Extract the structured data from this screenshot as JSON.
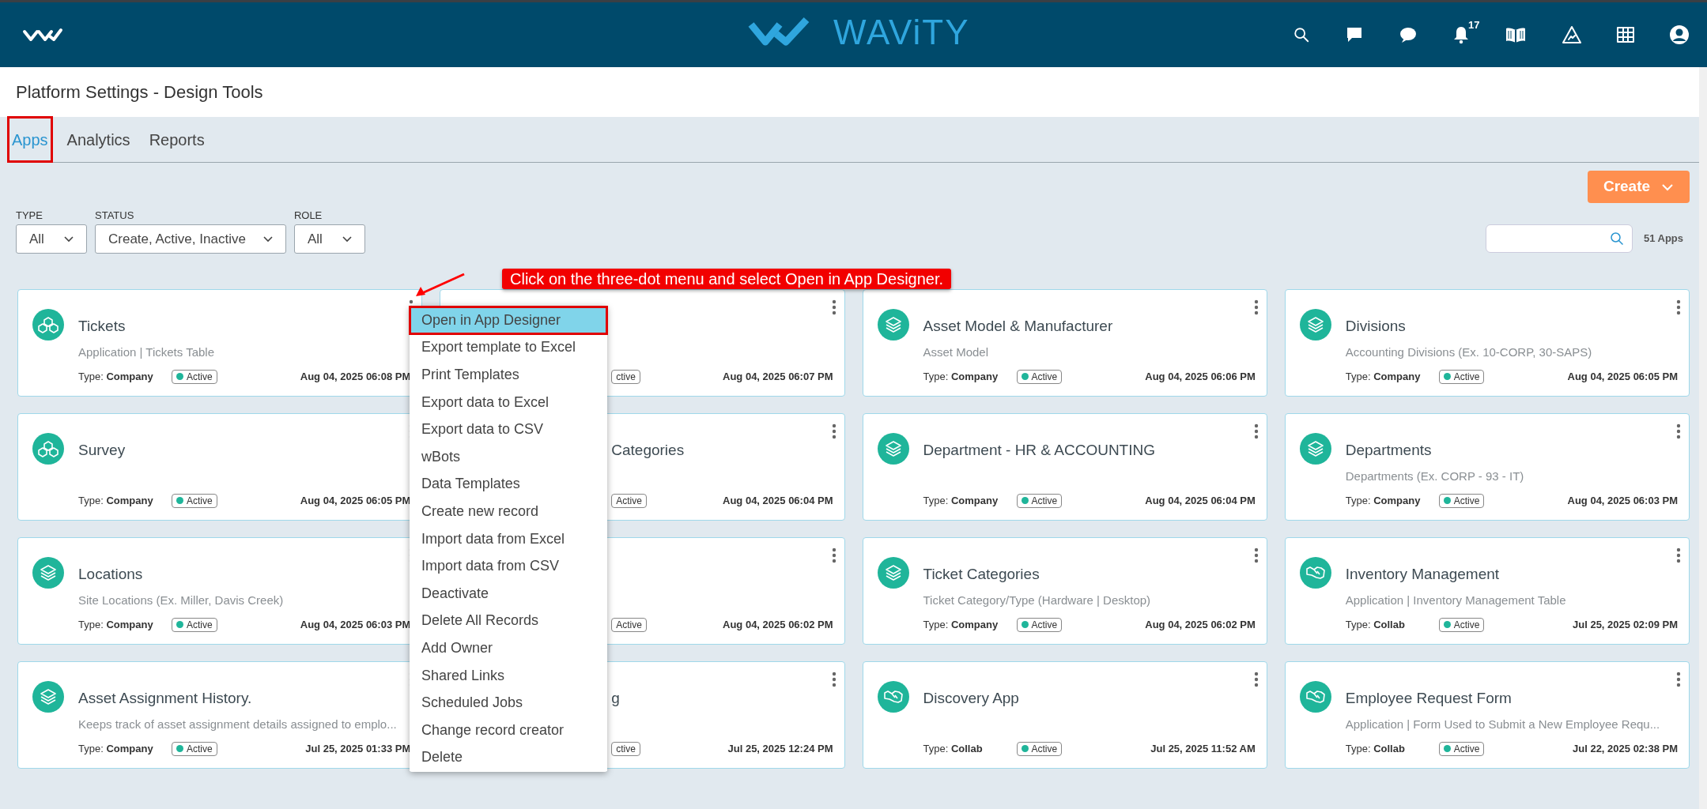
{
  "header": {
    "logo_text": "WAViTY",
    "notification_count": "17"
  },
  "page_title": "Platform Settings - Design Tools",
  "tabs": [
    {
      "label": "Apps",
      "selected": true,
      "highlighted": true
    },
    {
      "label": "Analytics",
      "selected": false,
      "highlighted": false
    },
    {
      "label": "Reports",
      "selected": false,
      "highlighted": false
    }
  ],
  "create_button": "Create",
  "filters": [
    {
      "label": "TYPE",
      "value": "All"
    },
    {
      "label": "STATUS",
      "value": "Create, Active, Inactive"
    },
    {
      "label": "ROLE",
      "value": "All"
    }
  ],
  "app_count": "51 Apps",
  "annotation": {
    "text": "Click on the three-dot menu and select Open in App Designer."
  },
  "cards": [
    {
      "kind": "cubes",
      "covered": false,
      "title": "Tickets",
      "subtitle": "Application | Tickets Table",
      "type_label": "Type:",
      "type": "Company",
      "status": "Active",
      "date": "Aug 04, 2025 06:08 PM"
    },
    {
      "covered": true,
      "status": "ctive",
      "date": "Aug 04, 2025 06:07 PM"
    },
    {
      "kind": "layers",
      "covered": false,
      "title": "Asset Model & Manufacturer",
      "subtitle": "Asset Model",
      "type_label": "Type:",
      "type": "Company",
      "status": "Active",
      "date": "Aug 04, 2025 06:06 PM"
    },
    {
      "kind": "layers",
      "covered": false,
      "title": "Divisions",
      "subtitle": "Accounting Divisions (Ex. 10-CORP, 30-SAPS)",
      "type_label": "Type:",
      "type": "Company",
      "status": "Active",
      "date": "Aug 04, 2025 06:05 PM"
    },
    {
      "kind": "cubes",
      "covered": false,
      "title": "Survey",
      "type_label": "Type:",
      "type": "Company",
      "status": "Active",
      "date": "Aug 04, 2025 06:05 PM"
    },
    {
      "covered": true,
      "title": "Categories",
      "status": "Active",
      "date": "Aug 04, 2025 06:04 PM"
    },
    {
      "kind": "layers",
      "covered": false,
      "title": "Department - HR & ACCOUNTING",
      "type_label": "Type:",
      "type": "Company",
      "status": "Active",
      "date": "Aug 04, 2025 06:04 PM"
    },
    {
      "kind": "layers",
      "covered": false,
      "title": "Departments",
      "subtitle": "Departments (Ex. CORP - 93 - IT)",
      "type_label": "Type:",
      "type": "Company",
      "status": "Active",
      "date": "Aug 04, 2025 06:03 PM"
    },
    {
      "kind": "layers",
      "covered": false,
      "title": "Locations",
      "subtitle": "Site Locations (Ex. Miller, Davis Creek)",
      "type_label": "Type:",
      "type": "Company",
      "status": "Active",
      "date": "Aug 04, 2025 06:03 PM"
    },
    {
      "covered": true,
      "status": "Active",
      "date": "Aug 04, 2025 06:02 PM"
    },
    {
      "kind": "layers",
      "covered": false,
      "title": "Ticket Categories",
      "subtitle": "Ticket Category/Type (Hardware | Desktop)",
      "type_label": "Type:",
      "type": "Company",
      "status": "Active",
      "date": "Aug 04, 2025 06:02 PM"
    },
    {
      "kind": "handshake",
      "covered": false,
      "title": "Inventory Management",
      "subtitle": "Application | Inventory Management Table",
      "type_label": "Type:",
      "type": "Collab",
      "status": "Active",
      "date": "Jul 25, 2025 02:09 PM"
    },
    {
      "kind": "layers",
      "covered": false,
      "title": "Asset Assignment History.",
      "subtitle": "Keeps track of asset assignment details assigned to emplo...",
      "type_label": "Type:",
      "type": "Company",
      "status": "Active",
      "date": "Jul 25, 2025 01:33 PM"
    },
    {
      "covered": true,
      "title": "g",
      "status": "ctive",
      "date": "Jul 25, 2025 12:24 PM"
    },
    {
      "kind": "handshake",
      "covered": false,
      "title": "Discovery App",
      "type_label": "Type:",
      "type": "Collab",
      "status": "Active",
      "date": "Jul 25, 2025 11:52 AM"
    },
    {
      "kind": "handshake",
      "covered": false,
      "title": "Employee Request Form",
      "subtitle": "Application | Form Used to Submit a New Employee Requ...",
      "type_label": "Type:",
      "type": "Collab",
      "status": "Active",
      "date": "Jul 22, 2025 02:38 PM"
    }
  ],
  "context_menu": [
    {
      "label": "Open in App Designer",
      "selected": true,
      "highlighted": true
    },
    {
      "label": "Export template to Excel",
      "selected": false,
      "highlighted": false
    },
    {
      "label": "Print Templates",
      "selected": false,
      "highlighted": false
    },
    {
      "label": "Export data to Excel",
      "selected": false,
      "highlighted": false
    },
    {
      "label": "Export data to CSV",
      "selected": false,
      "highlighted": false
    },
    {
      "label": "wBots",
      "selected": false,
      "highlighted": false
    },
    {
      "label": "Data Templates",
      "selected": false,
      "highlighted": false
    },
    {
      "label": "Create new record",
      "selected": false,
      "highlighted": false
    },
    {
      "label": "Import data from Excel",
      "selected": false,
      "highlighted": false
    },
    {
      "label": "Import data from CSV",
      "selected": false,
      "highlighted": false
    },
    {
      "label": "Deactivate",
      "selected": false,
      "highlighted": false
    },
    {
      "label": "Delete All Records",
      "selected": false,
      "highlighted": false
    },
    {
      "label": "Add Owner",
      "selected": false,
      "highlighted": false
    },
    {
      "label": "Shared Links",
      "selected": false,
      "highlighted": false
    },
    {
      "label": "Scheduled Jobs",
      "selected": false,
      "highlighted": false
    },
    {
      "label": "Change record creator",
      "selected": false,
      "highlighted": false
    },
    {
      "label": "Delete",
      "selected": false,
      "highlighted": false
    }
  ]
}
